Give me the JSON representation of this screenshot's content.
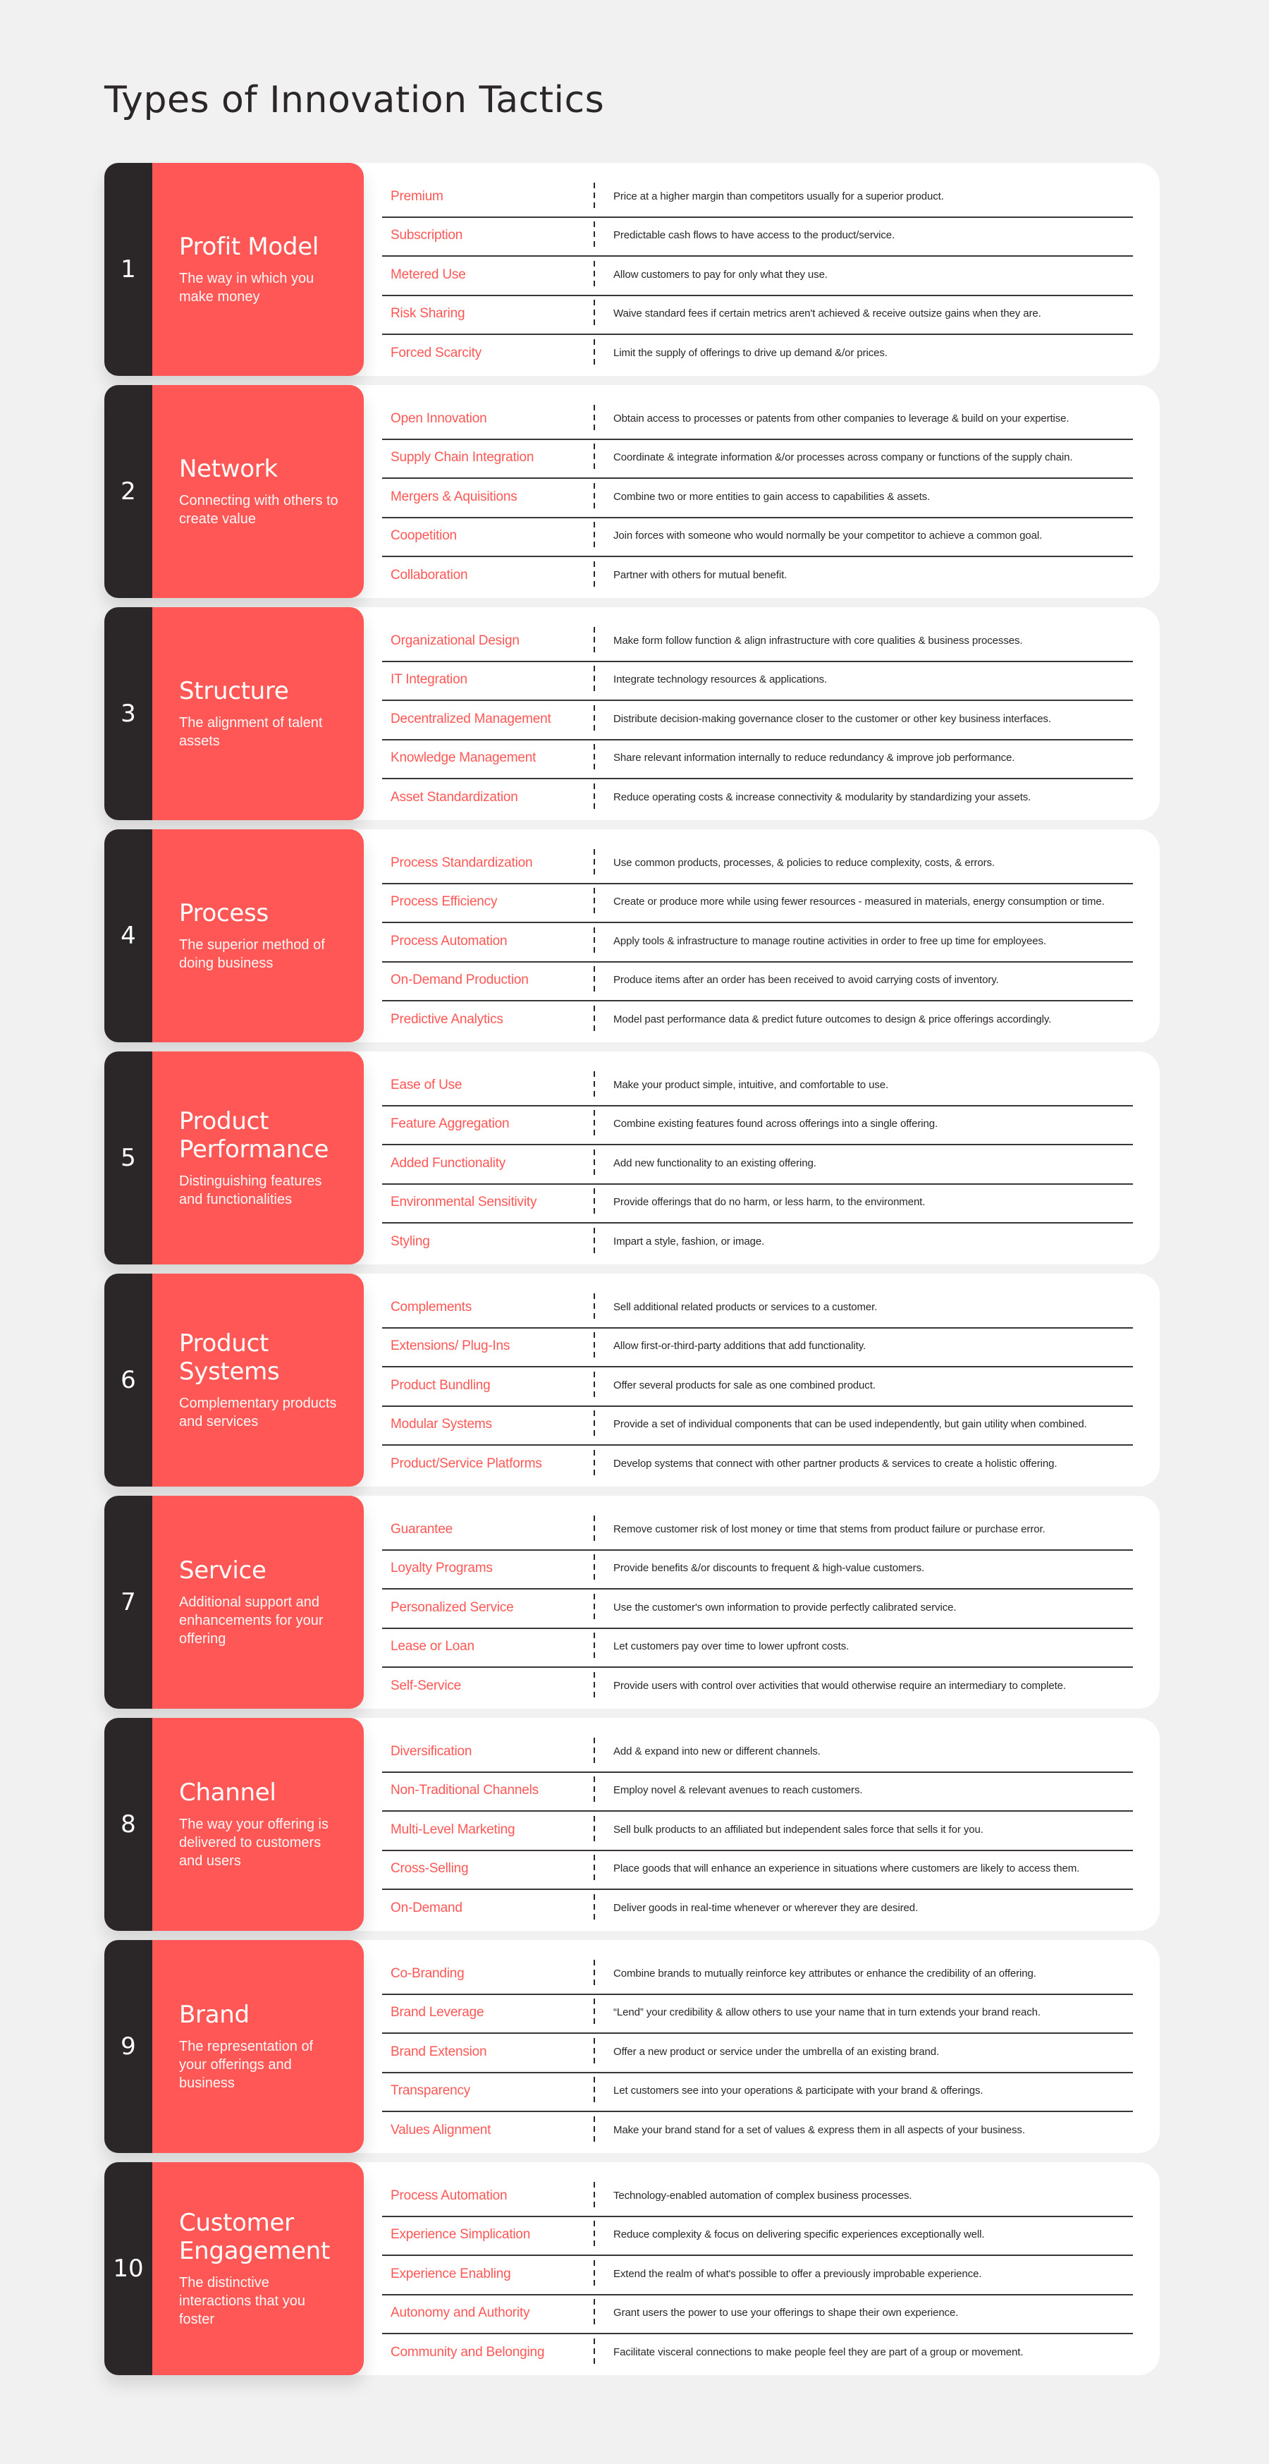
{
  "page": {
    "title": "Types of Innovation Tactics"
  },
  "colors": {
    "accent": "#ff5755",
    "dark": "#2b2628",
    "background": "#f2f1f1",
    "panel": "#ffffff"
  },
  "categories": [
    {
      "number": "1",
      "title": "Profit Model",
      "subtitle": "The way in which you make money",
      "tactics": [
        {
          "name": "Premium",
          "description": "Price at a higher margin than competitors usually for a superior product."
        },
        {
          "name": "Subscription",
          "description": "Predictable cash flows to have access to the product/service."
        },
        {
          "name": "Metered Use",
          "description": "Allow customers to pay for only what they use."
        },
        {
          "name": "Risk Sharing",
          "description": "Waive standard fees if certain metrics aren't achieved & receive outsize gains when they are."
        },
        {
          "name": "Forced Scarcity",
          "description": "Limit the supply of offerings to drive up demand &/or prices."
        }
      ]
    },
    {
      "number": "2",
      "title": "Network",
      "subtitle": "Connecting with others to create value",
      "tactics": [
        {
          "name": "Open Innovation",
          "description": "Obtain access to processes or patents from  other companies to leverage  & build on your expertise."
        },
        {
          "name": "Supply Chain Integration",
          "description": "Coordinate & integrate information &/or processes across company or functions of the supply chain."
        },
        {
          "name": "Mergers & Aquisitions",
          "description": "Combine two or more entities to gain access to capabilities & assets."
        },
        {
          "name": "Coopetition",
          "description": "Join forces with someone who would normally be your competitor to achieve a common goal."
        },
        {
          "name": "Collaboration",
          "description": "Partner with others for mutual benefit."
        }
      ]
    },
    {
      "number": "3",
      "title": "Structure",
      "subtitle": "The alignment of talent assets",
      "tactics": [
        {
          "name": "Organizational Design",
          "description": "Make form follow function & align infrastructure with core qualities & business processes."
        },
        {
          "name": "IT Integration",
          "description": "Integrate technology resources & applications."
        },
        {
          "name": "Decentralized Management",
          "description": "Distribute decision-making governance closer to the customer or other key business interfaces."
        },
        {
          "name": "Knowledge Management",
          "description": "Share relevant information internally to reduce redundancy & improve job performance."
        },
        {
          "name": "Asset Standardization",
          "description": "Reduce operating costs & increase connectivity & modularity by standardizing your assets."
        }
      ]
    },
    {
      "number": "4",
      "title": "Process",
      "subtitle": "The superior method of doing business",
      "tactics": [
        {
          "name": "Process Standardization",
          "description": "Use common products, processes, & policies to reduce complexity, costs, & errors."
        },
        {
          "name": "Process Efficiency",
          "description": "Create or produce more while using fewer resources - measured in materials, energy consumption or time."
        },
        {
          "name": "Process Automation",
          "description": "Apply tools & infrastructure to manage routine activities in order to free up time for employees."
        },
        {
          "name": "On-Demand Production",
          "description": "Produce items after an order has been received to avoid carrying costs of inventory."
        },
        {
          "name": "Predictive Analytics",
          "description": "Model past performance data & predict future outcomes to design & price offerings accordingly."
        }
      ]
    },
    {
      "number": "5",
      "title": "Product Performance",
      "subtitle": "Distinguishing features and functionalities",
      "tactics": [
        {
          "name": "Ease of Use",
          "description": "Make your product simple, intuitive, and comfortable to use."
        },
        {
          "name": "Feature Aggregation",
          "description": "Combine existing features found across offerings into a single offering."
        },
        {
          "name": "Added Functionality",
          "description": "Add new functionality to an existing offering."
        },
        {
          "name": "Environmental Sensitivity",
          "description": "Provide offerings that do no harm, or less harm, to the environment."
        },
        {
          "name": "Styling",
          "description": "Impart a style, fashion, or image."
        }
      ]
    },
    {
      "number": "6",
      "title": "Product Systems",
      "subtitle": "Complementary products and services",
      "tactics": [
        {
          "name": "Complements",
          "description": "Sell additional related products or services to a customer."
        },
        {
          "name": "Extensions/ Plug-Ins",
          "description": "Allow first-or-third-party additions that add functionality."
        },
        {
          "name": "Product Bundling",
          "description": "Offer several products for sale as one combined product."
        },
        {
          "name": "Modular Systems",
          "description": "Provide a set of individual components that can be used independently, but gain utility when combined."
        },
        {
          "name": "Product/Service Platforms",
          "description": "Develop systems that connect with other partner products & services to create a holistic offering."
        }
      ]
    },
    {
      "number": "7",
      "title": "Service",
      "subtitle": "Additional support and enhancements for your offering",
      "tactics": [
        {
          "name": "Guarantee",
          "description": "Remove customer risk of lost money or time that stems from product failure or purchase error."
        },
        {
          "name": "Loyalty Programs",
          "description": "Provide benefits &/or discounts to frequent & high-value customers."
        },
        {
          "name": "Personalized Service",
          "description": "Use the customer's own information to provide perfectly calibrated service."
        },
        {
          "name": "Lease or Loan",
          "description": "Let customers pay over time to lower upfront costs."
        },
        {
          "name": "Self-Service",
          "description": "Provide users with control over activities that would otherwise require an intermediary to complete."
        }
      ]
    },
    {
      "number": "8",
      "title": "Channel",
      "subtitle": "The way your offering is delivered to customers and users",
      "tactics": [
        {
          "name": "Diversification",
          "description": "Add & expand into new or different channels."
        },
        {
          "name": "Non-Traditional Channels",
          "description": "Employ novel & relevant avenues to reach customers."
        },
        {
          "name": "Multi-Level Marketing",
          "description": "Sell bulk products to an affiliated but independent sales force that sells it for you."
        },
        {
          "name": "Cross-Selling",
          "description": "Place goods that will enhance an experience in situations where customers are likely to  access them."
        },
        {
          "name": "On-Demand",
          "description": "Deliver goods in real-time whenever or wherever they are desired."
        }
      ]
    },
    {
      "number": "9",
      "title": "Brand",
      "subtitle": "The representation of your offerings and business",
      "tactics": [
        {
          "name": "Co-Branding",
          "description": "Combine brands to mutually reinforce key attributes or enhance the credibility of an offering."
        },
        {
          "name": "Brand Leverage",
          "description": "“Lend” your credibility & allow others to use your  name that in turn extends your brand reach."
        },
        {
          "name": "Brand Extension",
          "description": "Offer a new product or service under the umbrella of an existing brand."
        },
        {
          "name": "Transparency",
          "description": "Let customers see into your operations & participate with your brand & offerings."
        },
        {
          "name": "Values Alignment",
          "description": "Make your brand stand for a set of values & express them in all aspects of your business."
        }
      ]
    },
    {
      "number": "10",
      "title": "Customer Engagement",
      "subtitle": "The distinctive interactions that you foster",
      "tactics": [
        {
          "name": "Process Automation",
          "description": "Technology-enabled automation of complex business processes."
        },
        {
          "name": "Experience Simplication",
          "description": "Reduce complexity & focus on delivering specific experiences exceptionally well."
        },
        {
          "name": "Experience Enabling",
          "description": "Extend the realm of what's possible to offer a previously improbable experience."
        },
        {
          "name": "Autonomy and Authority",
          "description": "Grant users the power to use your offerings to shape their own experience."
        },
        {
          "name": "Community and Belonging",
          "description": "Facilitate visceral connections to make people feel they are part of a group or movement."
        }
      ]
    }
  ]
}
